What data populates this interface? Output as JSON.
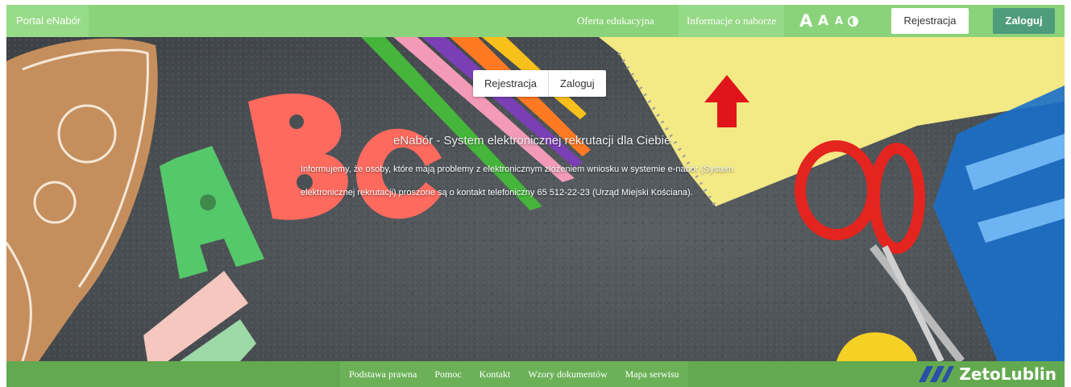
{
  "nav": {
    "brand": "Portal eNabór",
    "links": [
      "Oferta edukacyjna",
      "Informacje o naborze"
    ],
    "font_sizes": [
      "A",
      "A",
      "A"
    ],
    "contrast_icon": "contrast-icon",
    "register": "Rejestracja",
    "login": "Zaloguj"
  },
  "hero": {
    "register": "Rejestracja",
    "login": "Zaloguj",
    "title": "eNabór - System elektronicznej rekrutacji  dla Ciebie",
    "text": "Informujemy, że osoby, które mają problemy z elektronicznym złożeniem wniosku w systemie e-nabór (System elektronicznej rekrutacji) proszone są o kontakt telefoniczny 65 512-22-23 (Urząd Miejski Kościana).",
    "arrow_icon": "red-up-arrow-icon"
  },
  "footer": {
    "links": [
      "Podstawa prawna",
      "Pomoc",
      "Kontakt",
      "Wzory dokumentów",
      "Mapa serwisu"
    ],
    "logo": "ZetoLublin"
  },
  "colors": {
    "topbar": "#8bd37a",
    "footer": "#63a94f",
    "login_button": "#4f9c7c",
    "arrow": "#e0151b"
  }
}
